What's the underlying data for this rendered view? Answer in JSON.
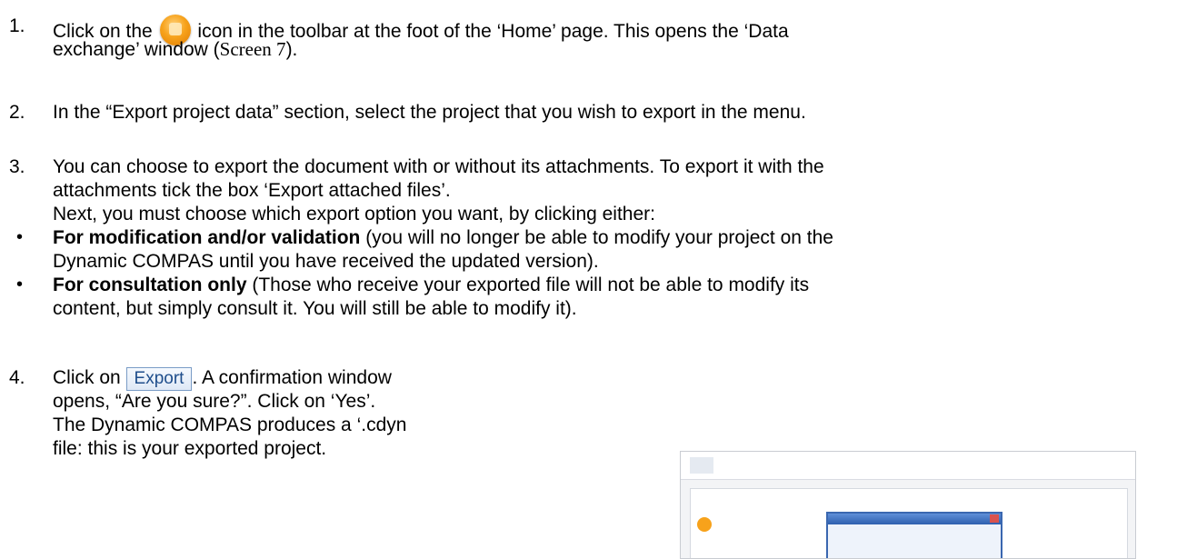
{
  "step1": {
    "number": "1.",
    "text_before_icon": "Click on the",
    "icon": "data-exchange-icon",
    "text_after_icon": "icon in the toolbar at the foot of the ‘Home’ page. This opens the ‘Data",
    "line2": "exchange’ window (",
    "screen_ref": "Screen 7",
    "line2_end": ")."
  },
  "step2": {
    "number": "2.",
    "text": "In the “Export project data” section, select the project that you wish to export in the menu."
  },
  "step3": {
    "number": "3.",
    "line1": "You can choose to export the document with or without its attachments. To export it with the",
    "line2": "attachments tick the box ‘Export attached files’.",
    "line3": "Next, you must choose which export option you want, by clicking either:"
  },
  "bullets": [
    {
      "bold": "For modification and/or validation",
      "line1_rest": " (you will no longer be able to modify your project on the",
      "line2": "Dynamic COMPAS until you have received the updated version)."
    },
    {
      "bold": "For consultation only",
      "line1_rest": " (Those who receive your exported file will not be able to modify its",
      "line2": "content, but simply consult it. You will still be able to modify it)."
    }
  ],
  "step4": {
    "number": "4.",
    "text_before_button": "Click on",
    "button_label": "Export",
    "text_after_button": ". A confirmation window",
    "line2": "opens, “Are you sure?”. Click on ‘Yes’.",
    "line3": "The Dynamic COMPAS produces a ‘.cdyn",
    "line4": "file: this is your exported project."
  },
  "colors": {
    "icon_orange": "#f7a21b",
    "button_text": "#1f4e8c",
    "dialog_blue": "#3a67b0"
  }
}
